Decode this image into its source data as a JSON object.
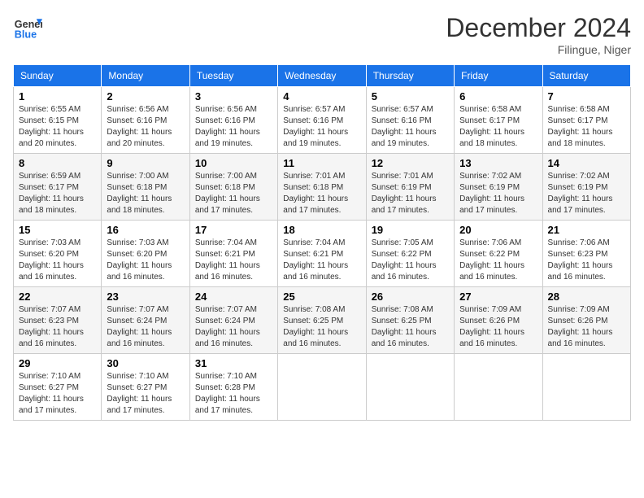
{
  "header": {
    "logo_line1": "General",
    "logo_line2": "Blue",
    "month": "December 2024",
    "location": "Filingue, Niger"
  },
  "weekdays": [
    "Sunday",
    "Monday",
    "Tuesday",
    "Wednesday",
    "Thursday",
    "Friday",
    "Saturday"
  ],
  "weeks": [
    [
      {
        "day": "1",
        "sunrise": "6:55 AM",
        "sunset": "6:15 PM",
        "daylight": "11 hours and 20 minutes."
      },
      {
        "day": "2",
        "sunrise": "6:56 AM",
        "sunset": "6:16 PM",
        "daylight": "11 hours and 20 minutes."
      },
      {
        "day": "3",
        "sunrise": "6:56 AM",
        "sunset": "6:16 PM",
        "daylight": "11 hours and 19 minutes."
      },
      {
        "day": "4",
        "sunrise": "6:57 AM",
        "sunset": "6:16 PM",
        "daylight": "11 hours and 19 minutes."
      },
      {
        "day": "5",
        "sunrise": "6:57 AM",
        "sunset": "6:16 PM",
        "daylight": "11 hours and 19 minutes."
      },
      {
        "day": "6",
        "sunrise": "6:58 AM",
        "sunset": "6:17 PM",
        "daylight": "11 hours and 18 minutes."
      },
      {
        "day": "7",
        "sunrise": "6:58 AM",
        "sunset": "6:17 PM",
        "daylight": "11 hours and 18 minutes."
      }
    ],
    [
      {
        "day": "8",
        "sunrise": "6:59 AM",
        "sunset": "6:17 PM",
        "daylight": "11 hours and 18 minutes."
      },
      {
        "day": "9",
        "sunrise": "7:00 AM",
        "sunset": "6:18 PM",
        "daylight": "11 hours and 18 minutes."
      },
      {
        "day": "10",
        "sunrise": "7:00 AM",
        "sunset": "6:18 PM",
        "daylight": "11 hours and 17 minutes."
      },
      {
        "day": "11",
        "sunrise": "7:01 AM",
        "sunset": "6:18 PM",
        "daylight": "11 hours and 17 minutes."
      },
      {
        "day": "12",
        "sunrise": "7:01 AM",
        "sunset": "6:19 PM",
        "daylight": "11 hours and 17 minutes."
      },
      {
        "day": "13",
        "sunrise": "7:02 AM",
        "sunset": "6:19 PM",
        "daylight": "11 hours and 17 minutes."
      },
      {
        "day": "14",
        "sunrise": "7:02 AM",
        "sunset": "6:19 PM",
        "daylight": "11 hours and 17 minutes."
      }
    ],
    [
      {
        "day": "15",
        "sunrise": "7:03 AM",
        "sunset": "6:20 PM",
        "daylight": "11 hours and 16 minutes."
      },
      {
        "day": "16",
        "sunrise": "7:03 AM",
        "sunset": "6:20 PM",
        "daylight": "11 hours and 16 minutes."
      },
      {
        "day": "17",
        "sunrise": "7:04 AM",
        "sunset": "6:21 PM",
        "daylight": "11 hours and 16 minutes."
      },
      {
        "day": "18",
        "sunrise": "7:04 AM",
        "sunset": "6:21 PM",
        "daylight": "11 hours and 16 minutes."
      },
      {
        "day": "19",
        "sunrise": "7:05 AM",
        "sunset": "6:22 PM",
        "daylight": "11 hours and 16 minutes."
      },
      {
        "day": "20",
        "sunrise": "7:06 AM",
        "sunset": "6:22 PM",
        "daylight": "11 hours and 16 minutes."
      },
      {
        "day": "21",
        "sunrise": "7:06 AM",
        "sunset": "6:23 PM",
        "daylight": "11 hours and 16 minutes."
      }
    ],
    [
      {
        "day": "22",
        "sunrise": "7:07 AM",
        "sunset": "6:23 PM",
        "daylight": "11 hours and 16 minutes."
      },
      {
        "day": "23",
        "sunrise": "7:07 AM",
        "sunset": "6:24 PM",
        "daylight": "11 hours and 16 minutes."
      },
      {
        "day": "24",
        "sunrise": "7:07 AM",
        "sunset": "6:24 PM",
        "daylight": "11 hours and 16 minutes."
      },
      {
        "day": "25",
        "sunrise": "7:08 AM",
        "sunset": "6:25 PM",
        "daylight": "11 hours and 16 minutes."
      },
      {
        "day": "26",
        "sunrise": "7:08 AM",
        "sunset": "6:25 PM",
        "daylight": "11 hours and 16 minutes."
      },
      {
        "day": "27",
        "sunrise": "7:09 AM",
        "sunset": "6:26 PM",
        "daylight": "11 hours and 16 minutes."
      },
      {
        "day": "28",
        "sunrise": "7:09 AM",
        "sunset": "6:26 PM",
        "daylight": "11 hours and 16 minutes."
      }
    ],
    [
      {
        "day": "29",
        "sunrise": "7:10 AM",
        "sunset": "6:27 PM",
        "daylight": "11 hours and 17 minutes."
      },
      {
        "day": "30",
        "sunrise": "7:10 AM",
        "sunset": "6:27 PM",
        "daylight": "11 hours and 17 minutes."
      },
      {
        "day": "31",
        "sunrise": "7:10 AM",
        "sunset": "6:28 PM",
        "daylight": "11 hours and 17 minutes."
      },
      null,
      null,
      null,
      null
    ]
  ]
}
